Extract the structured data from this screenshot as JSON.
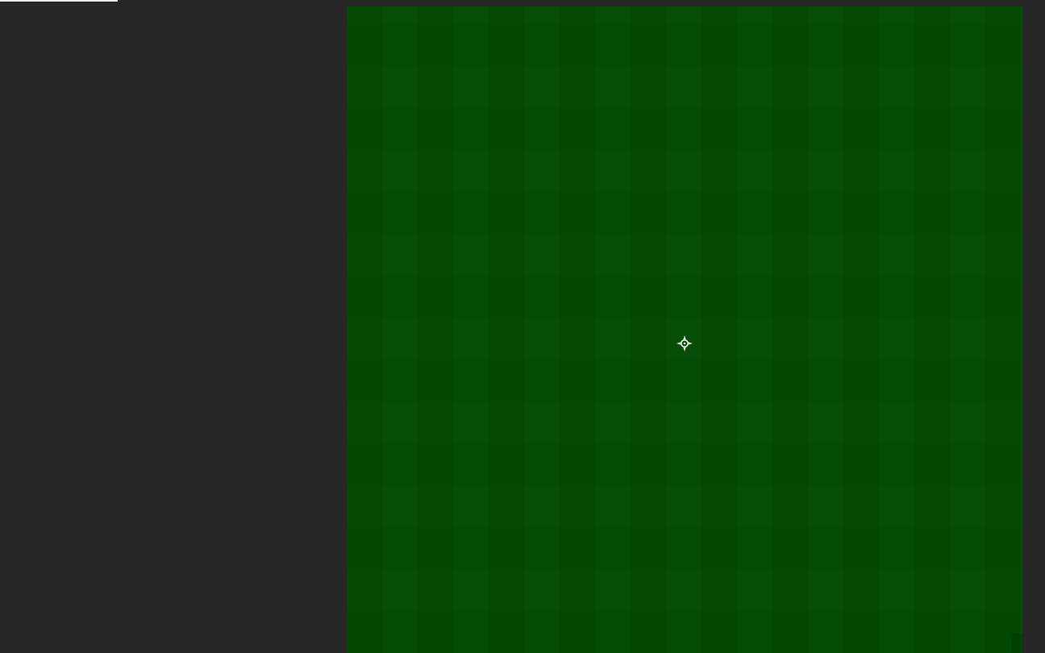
{
  "ui": {
    "background_color": "#262626",
    "game_area_color": "#024b02",
    "progress_color": "#e8e8e8"
  },
  "icons": {
    "target": "crosshair-icon"
  }
}
